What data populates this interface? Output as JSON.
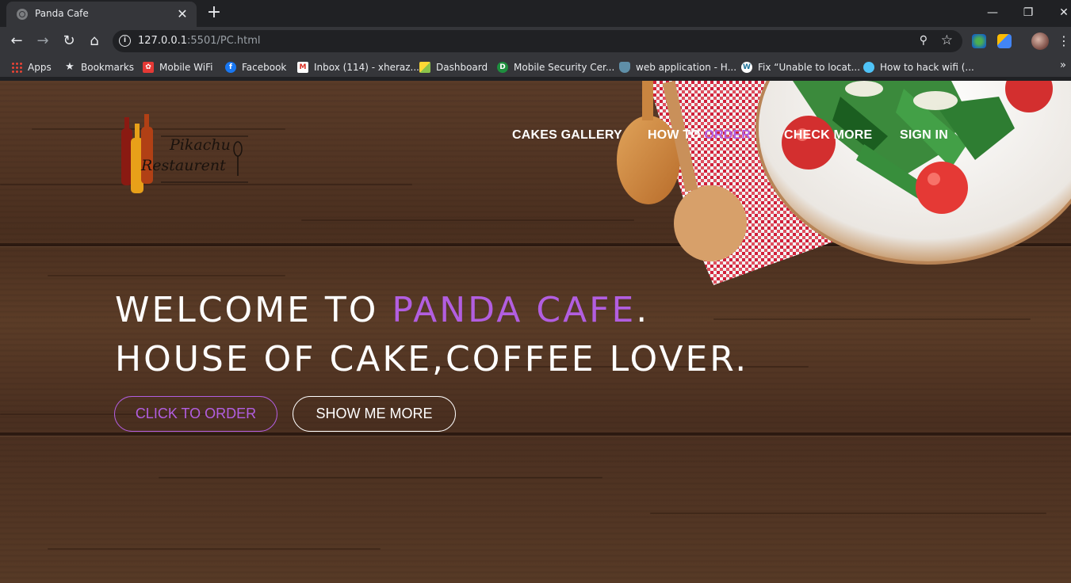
{
  "browser": {
    "tab": {
      "title": "Panda Cafe"
    },
    "url": {
      "host": "127.0.0.1",
      "rest": ":5501/PC.html"
    },
    "bookmarks": [
      {
        "label": "Apps",
        "icon": "apps-grid-icon"
      },
      {
        "label": "Bookmarks",
        "icon": "star-icon"
      },
      {
        "label": "Mobile WiFi",
        "icon": "huawei-icon"
      },
      {
        "label": "Facebook",
        "icon": "facebook-icon"
      },
      {
        "label": "Inbox (114) - xheraz...",
        "icon": "gmail-icon"
      },
      {
        "label": "Dashboard",
        "icon": "dashboard-icon"
      },
      {
        "label": "Mobile Security Cer...",
        "icon": "d-icon"
      },
      {
        "label": "web application - H...",
        "icon": "shield-icon"
      },
      {
        "label": "Fix “Unable to locat...",
        "icon": "wordpress-icon"
      },
      {
        "label": "How to hack wifi (...",
        "icon": "hacker-icon"
      }
    ]
  },
  "site": {
    "logo": {
      "line1": "Pikachu",
      "line2": "Restaurent"
    },
    "nav": {
      "cakes": "CAKES GALLERY",
      "how_prefix": "HOW TO ",
      "how_accent": "ORDER",
      "check": "CHECK MORE",
      "signin": "SIGN IN"
    },
    "hero": {
      "line1_prefix": "WELCOME TO ",
      "line1_accent": "PANDA CAFE",
      "line1_suffix": ".",
      "line2": "HOUSE OF CAKE,COFFEE LOVER."
    },
    "buttons": {
      "order": "CLICK TO ORDER",
      "more": "SHOW ME MORE"
    }
  },
  "colors": {
    "accent": "#b25ee0",
    "chrome_dark": "#202124",
    "chrome_mid": "#35363a"
  }
}
